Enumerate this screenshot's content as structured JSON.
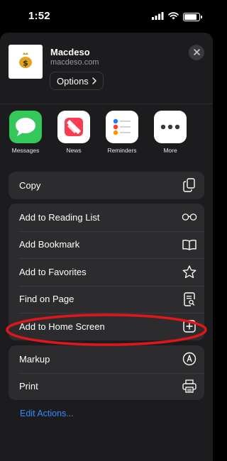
{
  "status_bar": {
    "time": "1:52",
    "battery_level_percent": 85
  },
  "header": {
    "site_name": "Macdeso",
    "site_url": "macdeso.com",
    "options_label": "Options",
    "thumb_icon": "money-bag-icon",
    "close_icon": "close-icon"
  },
  "apps": [
    {
      "label": "Messages",
      "icon": "messages-icon",
      "color": "#34c759"
    },
    {
      "label": "News",
      "icon": "news-icon",
      "color": "#ffffff"
    },
    {
      "label": "Reminders",
      "icon": "reminders-icon",
      "color": "#ffffff"
    },
    {
      "label": "More",
      "icon": "more-icon",
      "color": "#ffffff"
    }
  ],
  "actions": {
    "copy": {
      "label": "Copy",
      "icon": "copy-icon"
    },
    "group2": [
      {
        "label": "Add to Reading List",
        "icon": "glasses-icon"
      },
      {
        "label": "Add Bookmark",
        "icon": "book-icon"
      },
      {
        "label": "Add to Favorites",
        "icon": "star-icon"
      },
      {
        "label": "Find on Page",
        "icon": "find-icon"
      },
      {
        "label": "Add to Home Screen",
        "icon": "plus-square-icon"
      }
    ],
    "group3": [
      {
        "label": "Markup",
        "icon": "markup-icon"
      },
      {
        "label": "Print",
        "icon": "printer-icon"
      }
    ]
  },
  "edit_actions_label": "Edit Actions...",
  "colors": {
    "sheet_bg": "#1c1c1e",
    "group_bg": "#2c2c2e",
    "link": "#2f8cff",
    "highlight": "#e0161b"
  }
}
